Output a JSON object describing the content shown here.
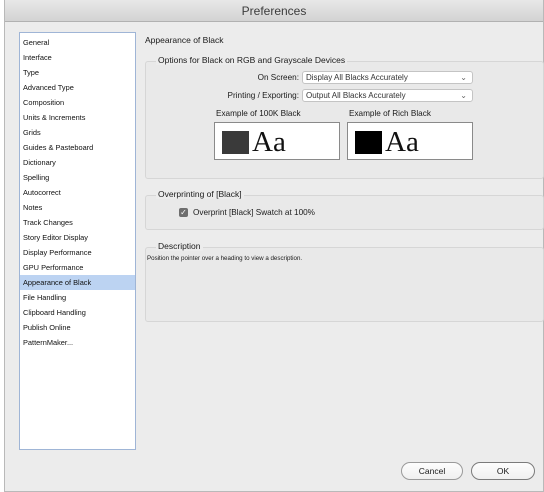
{
  "window": {
    "title": "Preferences"
  },
  "sidebar": {
    "items": [
      {
        "label": "General"
      },
      {
        "label": "Interface"
      },
      {
        "label": "Type"
      },
      {
        "label": "Advanced Type"
      },
      {
        "label": "Composition"
      },
      {
        "label": "Units & Increments"
      },
      {
        "label": "Grids"
      },
      {
        "label": "Guides & Pasteboard"
      },
      {
        "label": "Dictionary"
      },
      {
        "label": "Spelling"
      },
      {
        "label": "Autocorrect"
      },
      {
        "label": "Notes"
      },
      {
        "label": "Track Changes"
      },
      {
        "label": "Story Editor Display"
      },
      {
        "label": "Display Performance"
      },
      {
        "label": "GPU Performance"
      },
      {
        "label": "Appearance of Black"
      },
      {
        "label": "File Handling"
      },
      {
        "label": "Clipboard Handling"
      },
      {
        "label": "Publish Online"
      },
      {
        "label": "PatternMaker..."
      }
    ],
    "selected": "Appearance of Black",
    "selected_color": "#bcd3f2"
  },
  "main": {
    "heading": "Appearance of Black",
    "options": {
      "legend": "Options for Black on RGB and Grayscale Devices",
      "on_screen_label": "On Screen:",
      "on_screen_value": "Display All Blacks Accurately",
      "printing_label": "Printing / Exporting:",
      "printing_value": "Output All Blacks Accurately",
      "example_100k_label": "Example of 100K Black",
      "example_rich_label": "Example of Rich Black",
      "sample_text": "Aa",
      "swatch_100k_color": "#3a3a3a",
      "swatch_rich_color": "#000000"
    },
    "overprint": {
      "legend": "Overprinting of [Black]",
      "checkbox_label": "Overprint [Black] Swatch at 100%",
      "checked": true
    },
    "description": {
      "legend": "Description",
      "text": "Position the pointer over a heading to view a description."
    }
  },
  "buttons": {
    "cancel": "Cancel",
    "ok": "OK"
  }
}
